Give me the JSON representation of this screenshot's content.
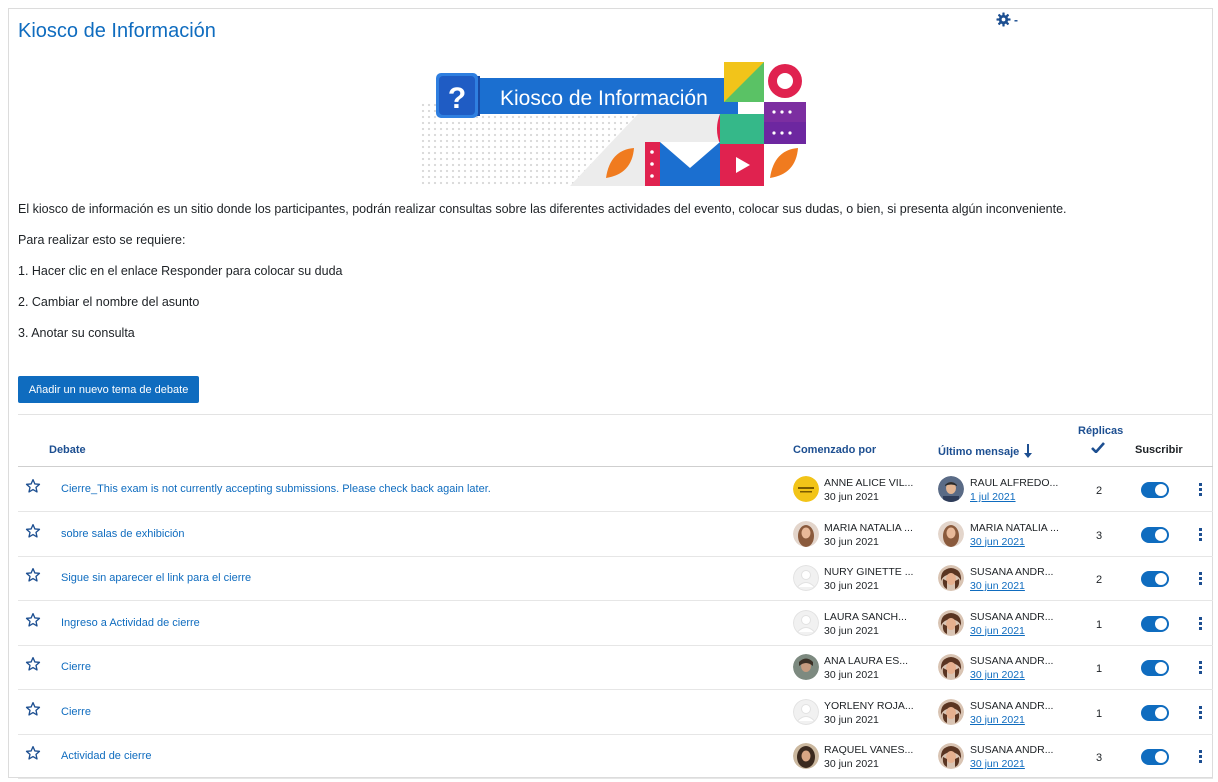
{
  "page": {
    "title": "Kiosco de Información",
    "banner_text": "Kiosco de Información",
    "banner_mark": "?"
  },
  "settings": {
    "icon": "gear-icon",
    "caret": "-"
  },
  "intro": {
    "p1": "El kiosco de información es un sitio donde los participantes, podrán realizar consultas sobre las diferentes actividades del evento, colocar sus dudas, o bien, si presenta algún inconveniente.",
    "p2": "Para realizar esto se requiere:",
    "p3": "1. Hacer clic en el enlace Responder para colocar su duda",
    "p4": "2. Cambiar el nombre del asunto",
    "p5": "3. Anotar su consulta"
  },
  "add_button": "Añadir un nuevo tema de debate",
  "table": {
    "headers": {
      "debate": "Debate",
      "started_by": "Comenzado por",
      "last_post": "Último mensaje",
      "replies": "Réplicas",
      "subscribe": "Suscribir"
    },
    "rows": [
      {
        "subject": "Cierre_This exam is not currently accepting submissions. Please check back again later.",
        "started_name": "ANNE ALICE VIL...",
        "started_date": "30 jun 2021",
        "last_name": "RAUL ALFREDO...",
        "last_date": "1 jul 2021",
        "replies": "2",
        "subscribed": true
      },
      {
        "subject": "sobre salas de exhibición",
        "started_name": "MARIA NATALIA ...",
        "started_date": "30 jun 2021",
        "last_name": "MARIA NATALIA ...",
        "last_date": "30 jun 2021",
        "replies": "3",
        "subscribed": true
      },
      {
        "subject": "Sigue sin aparecer el link para el cierre",
        "started_name": "NURY GINETTE ...",
        "started_date": "30 jun 2021",
        "last_name": "SUSANA ANDR...",
        "last_date": "30 jun 2021",
        "replies": "2",
        "subscribed": true
      },
      {
        "subject": "Ingreso a Actividad de cierre",
        "started_name": "LAURA SANCH...",
        "started_date": "30 jun 2021",
        "last_name": "SUSANA ANDR...",
        "last_date": "30 jun 2021",
        "replies": "1",
        "subscribed": true
      },
      {
        "subject": "Cierre",
        "started_name": "ANA LAURA ES...",
        "started_date": "30 jun 2021",
        "last_name": "SUSANA ANDR...",
        "last_date": "30 jun 2021",
        "replies": "1",
        "subscribed": true
      },
      {
        "subject": "Cierre",
        "started_name": "YORLENY ROJA...",
        "started_date": "30 jun 2021",
        "last_name": "SUSANA ANDR...",
        "last_date": "30 jun 2021",
        "replies": "1",
        "subscribed": true
      },
      {
        "subject": "Actividad de cierre",
        "started_name": "RAQUEL VANES...",
        "started_date": "30 jun 2021",
        "last_name": "SUSANA ANDR...",
        "last_date": "30 jun 2021",
        "replies": "3",
        "subscribed": true
      }
    ]
  },
  "colors": {
    "brand": "#0f6cbf",
    "header_link": "#1d4f91",
    "text": "#1d2125"
  }
}
